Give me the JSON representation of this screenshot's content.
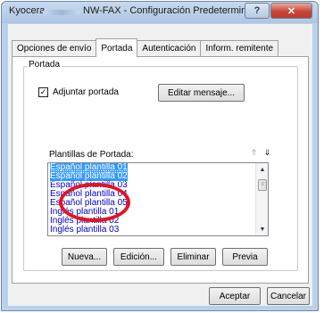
{
  "window": {
    "title_left": "Kyocera",
    "title_right": "NW-FAX - Configuración Predeterminada",
    "help_glyph": "?",
    "close_glyph": "✕"
  },
  "tabs": [
    {
      "label": "Opciones de envío",
      "active": false
    },
    {
      "label": "Portada",
      "active": true
    },
    {
      "label": "Autenticación",
      "active": false
    },
    {
      "label": "Inform. remitente",
      "active": false
    }
  ],
  "group": {
    "label": "Portada",
    "checkbox_label": "Adjuntar portada",
    "checkbox_checked": true,
    "edit_button": "Editar mensaje...",
    "templates_label": "Plantillas de Portada:",
    "sort_up_icon": "⇑",
    "sort_down_icon": "⇓",
    "templates": [
      {
        "label": "Español plantilla 01",
        "selected": true
      },
      {
        "label": "Español plantilla 02",
        "selected": true
      },
      {
        "label": "Español plantilla 03",
        "selected": false
      },
      {
        "label": "Español plantilla 04",
        "selected": false
      },
      {
        "label": "Español plantilla 05",
        "selected": false
      },
      {
        "label": "Inglés plantilla 01",
        "selected": false
      },
      {
        "label": "Inglés plantilla 02",
        "selected": false
      },
      {
        "label": "Inglés plantilla 03",
        "selected": false
      }
    ],
    "buttons": {
      "new": "Nueva...",
      "edit": "Edición...",
      "delete": "Eliminar",
      "preview": "Previa"
    }
  },
  "footer": {
    "accept": "Aceptar",
    "cancel": "Cancelar"
  },
  "colors": {
    "highlight_oval": "#e4141e",
    "selection": "#3399ff"
  }
}
